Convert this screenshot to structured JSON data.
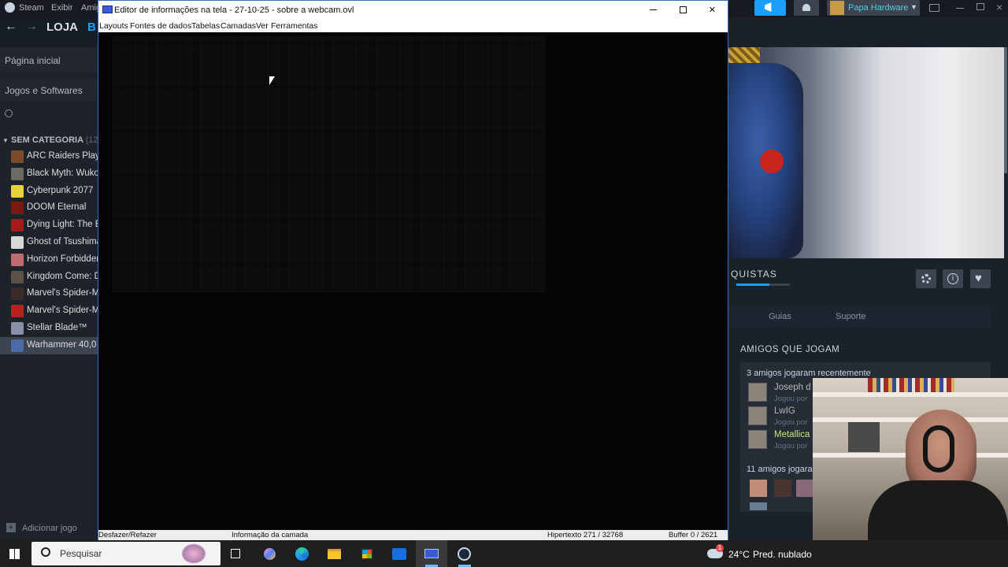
{
  "steam": {
    "menu": [
      "Steam",
      "Exibir",
      "Amig"
    ],
    "nav": {
      "store": "LOJA",
      "library_partial": "B"
    },
    "sidebar": {
      "home": "Página inicial",
      "filter": "Jogos e Softwares",
      "category": "SEM CATEGORIA",
      "category_count": "(12",
      "games": [
        {
          "name": "ARC Raiders Playt",
          "color": "#7a4a2a"
        },
        {
          "name": "Black Myth: Wuko",
          "color": "#6b6a64"
        },
        {
          "name": "Cyberpunk 2077",
          "color": "#e6d23a"
        },
        {
          "name": "DOOM Eternal",
          "color": "#7a1a14"
        },
        {
          "name": "Dying Light: The B",
          "color": "#a31b1b"
        },
        {
          "name": "Ghost of Tsushima",
          "color": "#d9d9d9"
        },
        {
          "name": "Horizon Forbidden",
          "color": "#c06a72"
        },
        {
          "name": "Kingdom Come: D",
          "color": "#5a5346"
        },
        {
          "name": "Marvel's Spider-M",
          "color": "#3a2a2a"
        },
        {
          "name": "Marvel's Spider-M",
          "color": "#b7221d"
        },
        {
          "name": "Stellar Blade™",
          "color": "#8a8fa6"
        },
        {
          "name": "Warhammer 40,0",
          "color": "#4a6aa8"
        }
      ],
      "add_game": "Adicionar jogo"
    },
    "user": {
      "name": "Papa Hardware"
    },
    "achievements_partial": "QUISTAS",
    "tabs": [
      "Guias",
      "Suporte"
    ],
    "friends": {
      "title": "AMIGOS QUE JOGAM",
      "recent": "3 amigos jogaram recentemente",
      "list": [
        {
          "name": "Joseph d",
          "sub": "Jogou por",
          "color": "#b7b7b7"
        },
        {
          "name": "LwIG",
          "sub": "Jogou por",
          "color": "#b7b7b7"
        },
        {
          "name": "Metallica",
          "sub": "Jogou por",
          "color": "#cfe37b"
        }
      ],
      "more": "11 amigos jogara"
    }
  },
  "editor": {
    "title": "Editor de informações na tela - 27-10-25 - sobre a webcam.ovl",
    "menu": [
      "Layouts",
      "Fontes de dados",
      "Tabelas",
      "Camadas",
      "Ver",
      "Ferramentas"
    ],
    "status": {
      "undo": "Desfazer/Refazer",
      "layer_info": "Informação da camada",
      "hypertext": "Hipertexto 271 / 32768",
      "buffer": "Buffer 0 / 2621"
    }
  },
  "taskbar": {
    "search_placeholder": "Pesquisar",
    "weather_temp": "24°C",
    "weather_desc": "Pred. nublado",
    "weather_badge": "1"
  }
}
